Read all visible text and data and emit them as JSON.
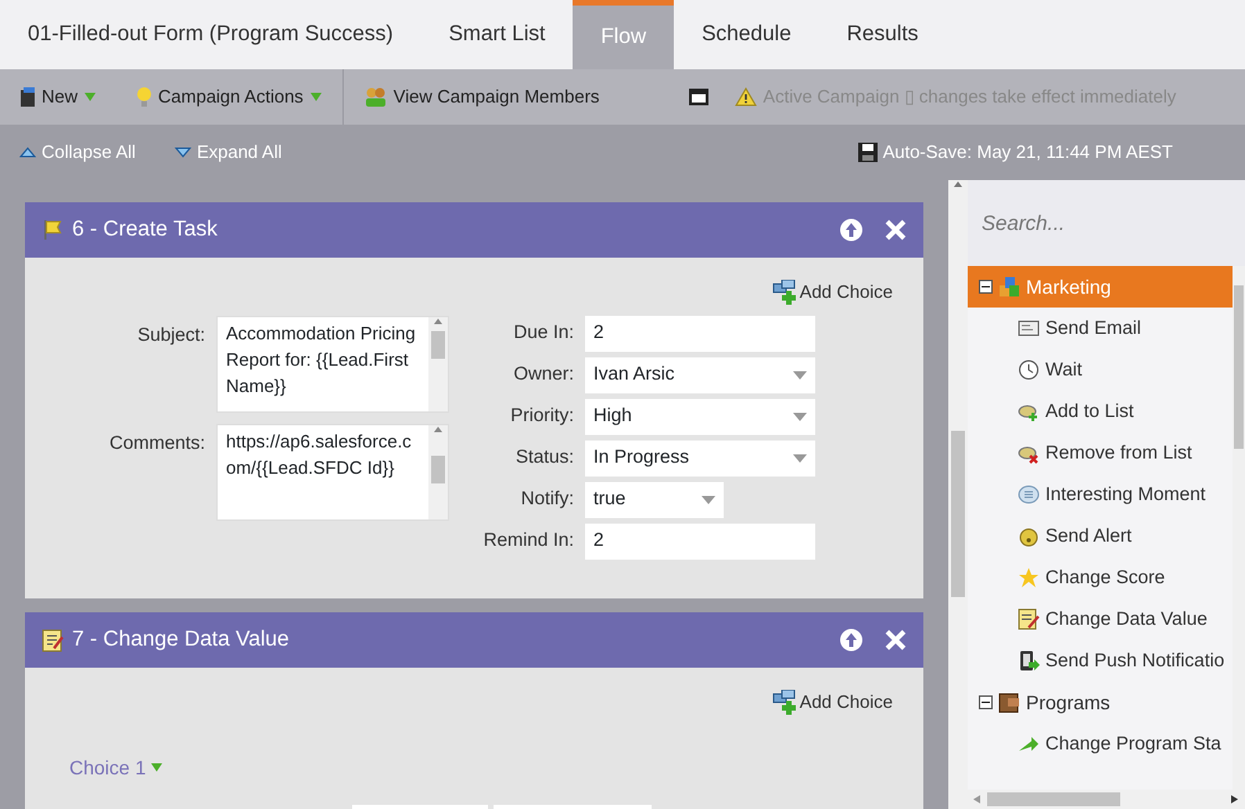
{
  "tabs": [
    {
      "label": "01-Filled-out Form (Program Success)",
      "selected": false
    },
    {
      "label": "Smart List",
      "selected": false
    },
    {
      "label": "Flow",
      "selected": true
    },
    {
      "label": "Schedule",
      "selected": false
    },
    {
      "label": "Results",
      "selected": false
    }
  ],
  "toolbar": {
    "new": "New",
    "campaign_actions": "Campaign Actions",
    "view_members": "View Campaign Members",
    "notice": "Active Campaign ▯ changes take effect immediately"
  },
  "subtoolbar": {
    "collapse": "Collapse All",
    "expand": "Expand All",
    "autosave": "Auto-Save: May 21, 11:44 PM AEST"
  },
  "steps": [
    {
      "title": "6 - Create Task",
      "add_choice": "Add Choice",
      "left_fields": [
        {
          "label": "Subject:",
          "value": "Accommodation Pricing Report for: {{Lead.First Name}}"
        },
        {
          "label": "Comments:",
          "value": "https://ap6.salesforce.com/{{Lead.SFDC Id}}"
        }
      ],
      "right_fields": [
        {
          "label": "Due In:",
          "value": "2",
          "kind": "text"
        },
        {
          "label": "Owner:",
          "value": "Ivan Arsic",
          "kind": "select"
        },
        {
          "label": "Priority:",
          "value": "High",
          "kind": "select"
        },
        {
          "label": "Status:",
          "value": "In Progress",
          "kind": "select"
        },
        {
          "label": "Notify:",
          "value": "true",
          "kind": "short-select"
        },
        {
          "label": "Remind In:",
          "value": "2",
          "kind": "text"
        }
      ]
    },
    {
      "title": "7 - Change Data Value",
      "add_choice": "Add Choice",
      "choice": "Choice 1"
    }
  ],
  "palette": {
    "placeholder": "Search...",
    "groups": [
      {
        "label": "Marketing",
        "expanded": true,
        "selected": true,
        "children": [
          "Send Email",
          "Wait",
          "Add to List",
          "Remove from List",
          "Interesting Moment",
          "Send Alert",
          "Change Score",
          "Change Data Value",
          "Send Push Notificatio"
        ]
      },
      {
        "label": "Programs",
        "expanded": true,
        "selected": false,
        "children": [
          "Change Program Sta"
        ]
      }
    ]
  }
}
